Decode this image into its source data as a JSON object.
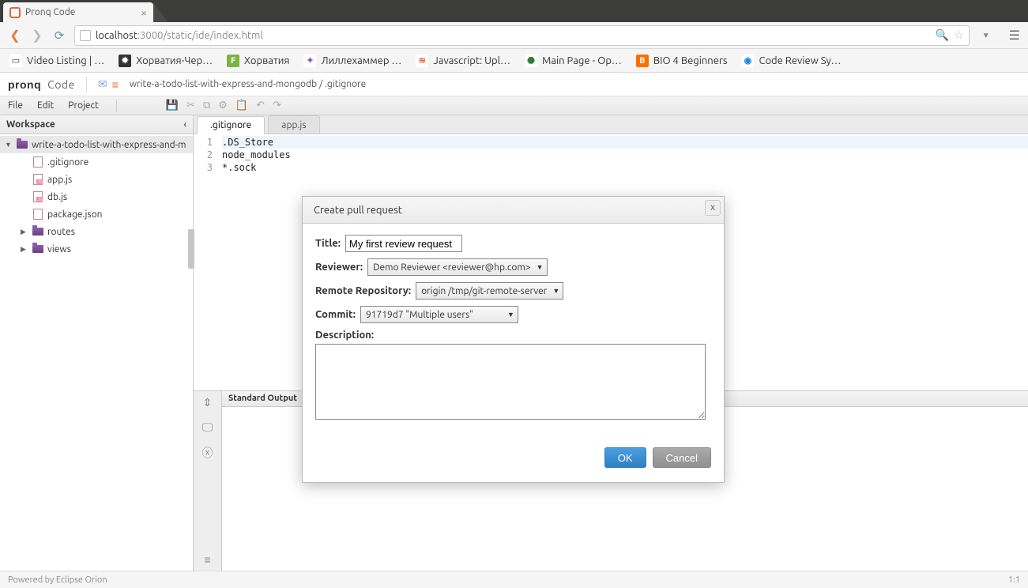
{
  "browser": {
    "tab_title": "Pronq Code",
    "url_host": "localhost",
    "url_port_path": ":3000/static/ide/index.html",
    "bookmarks": [
      {
        "label": "Video Listing | …",
        "icon_bg": "#fff",
        "icon_fg": "#888",
        "glyph": "▭"
      },
      {
        "label": "Хорватия-Чер…",
        "icon_bg": "#333",
        "icon_fg": "#fff",
        "glyph": "✸"
      },
      {
        "label": "Хорватия",
        "icon_bg": "#7cb342",
        "icon_fg": "#fff",
        "glyph": "F"
      },
      {
        "label": "Лиллехаммер …",
        "icon_bg": "#fff",
        "icon_fg": "#7e57c2",
        "glyph": "✦"
      },
      {
        "label": "Javascript: Upl…",
        "icon_bg": "#fff",
        "icon_fg": "#e0663c",
        "glyph": "≋"
      },
      {
        "label": "Main Page - Op…",
        "icon_bg": "#fff",
        "icon_fg": "#2e7d32",
        "glyph": "⬣"
      },
      {
        "label": "BIO 4 Beginners",
        "icon_bg": "#ff6d00",
        "icon_fg": "#fff",
        "glyph": "B"
      },
      {
        "label": "Code Review Sy…",
        "icon_bg": "#fff",
        "icon_fg": "#1e88e5",
        "glyph": "◉"
      }
    ]
  },
  "app": {
    "brand_primary": "pronq",
    "brand_sub": "Code",
    "breadcrumb": "write-a-todo-list-with-express-and-mongodb / .gitignore"
  },
  "menubar": {
    "items": [
      "File",
      "Edit",
      "Project"
    ]
  },
  "sidebar": {
    "title": "Workspace",
    "items": [
      {
        "label": "write-a-todo-list-with-express-and-m",
        "type": "folder",
        "expanded": true,
        "depth": 0,
        "selected": true
      },
      {
        "label": ".gitignore",
        "type": "file",
        "depth": 1
      },
      {
        "label": "app.js",
        "type": "js",
        "depth": 1
      },
      {
        "label": "db.js",
        "type": "js",
        "depth": 1
      },
      {
        "label": "package.json",
        "type": "file",
        "depth": 1
      },
      {
        "label": "routes",
        "type": "folder",
        "expanded": false,
        "depth": 1
      },
      {
        "label": "views",
        "type": "folder",
        "expanded": false,
        "depth": 1
      }
    ]
  },
  "editor": {
    "tabs": [
      {
        "label": ".gitignore",
        "active": true
      },
      {
        "label": "app.js",
        "active": false
      }
    ],
    "lines": [
      ".DS_Store",
      "node_modules",
      "*.sock"
    ]
  },
  "output": {
    "title": "Standard Output"
  },
  "dialog": {
    "title": "Create pull request",
    "close": "x",
    "fields": {
      "title_label": "Title:",
      "title_value": "My first review request",
      "reviewer_label": "Reviewer:",
      "reviewer_value": "Demo Reviewer <reviewer@hp.com>",
      "repo_label": "Remote Repository:",
      "repo_value": "origin /tmp/git-remote-server",
      "commit_label": "Commit:",
      "commit_value": "91719d7 \"Multiple users\"",
      "desc_label": "Description:"
    },
    "buttons": {
      "ok": "OK",
      "cancel": "Cancel"
    }
  },
  "footer": {
    "left": "Powered by Eclipse Orion",
    "right": "1:1"
  }
}
